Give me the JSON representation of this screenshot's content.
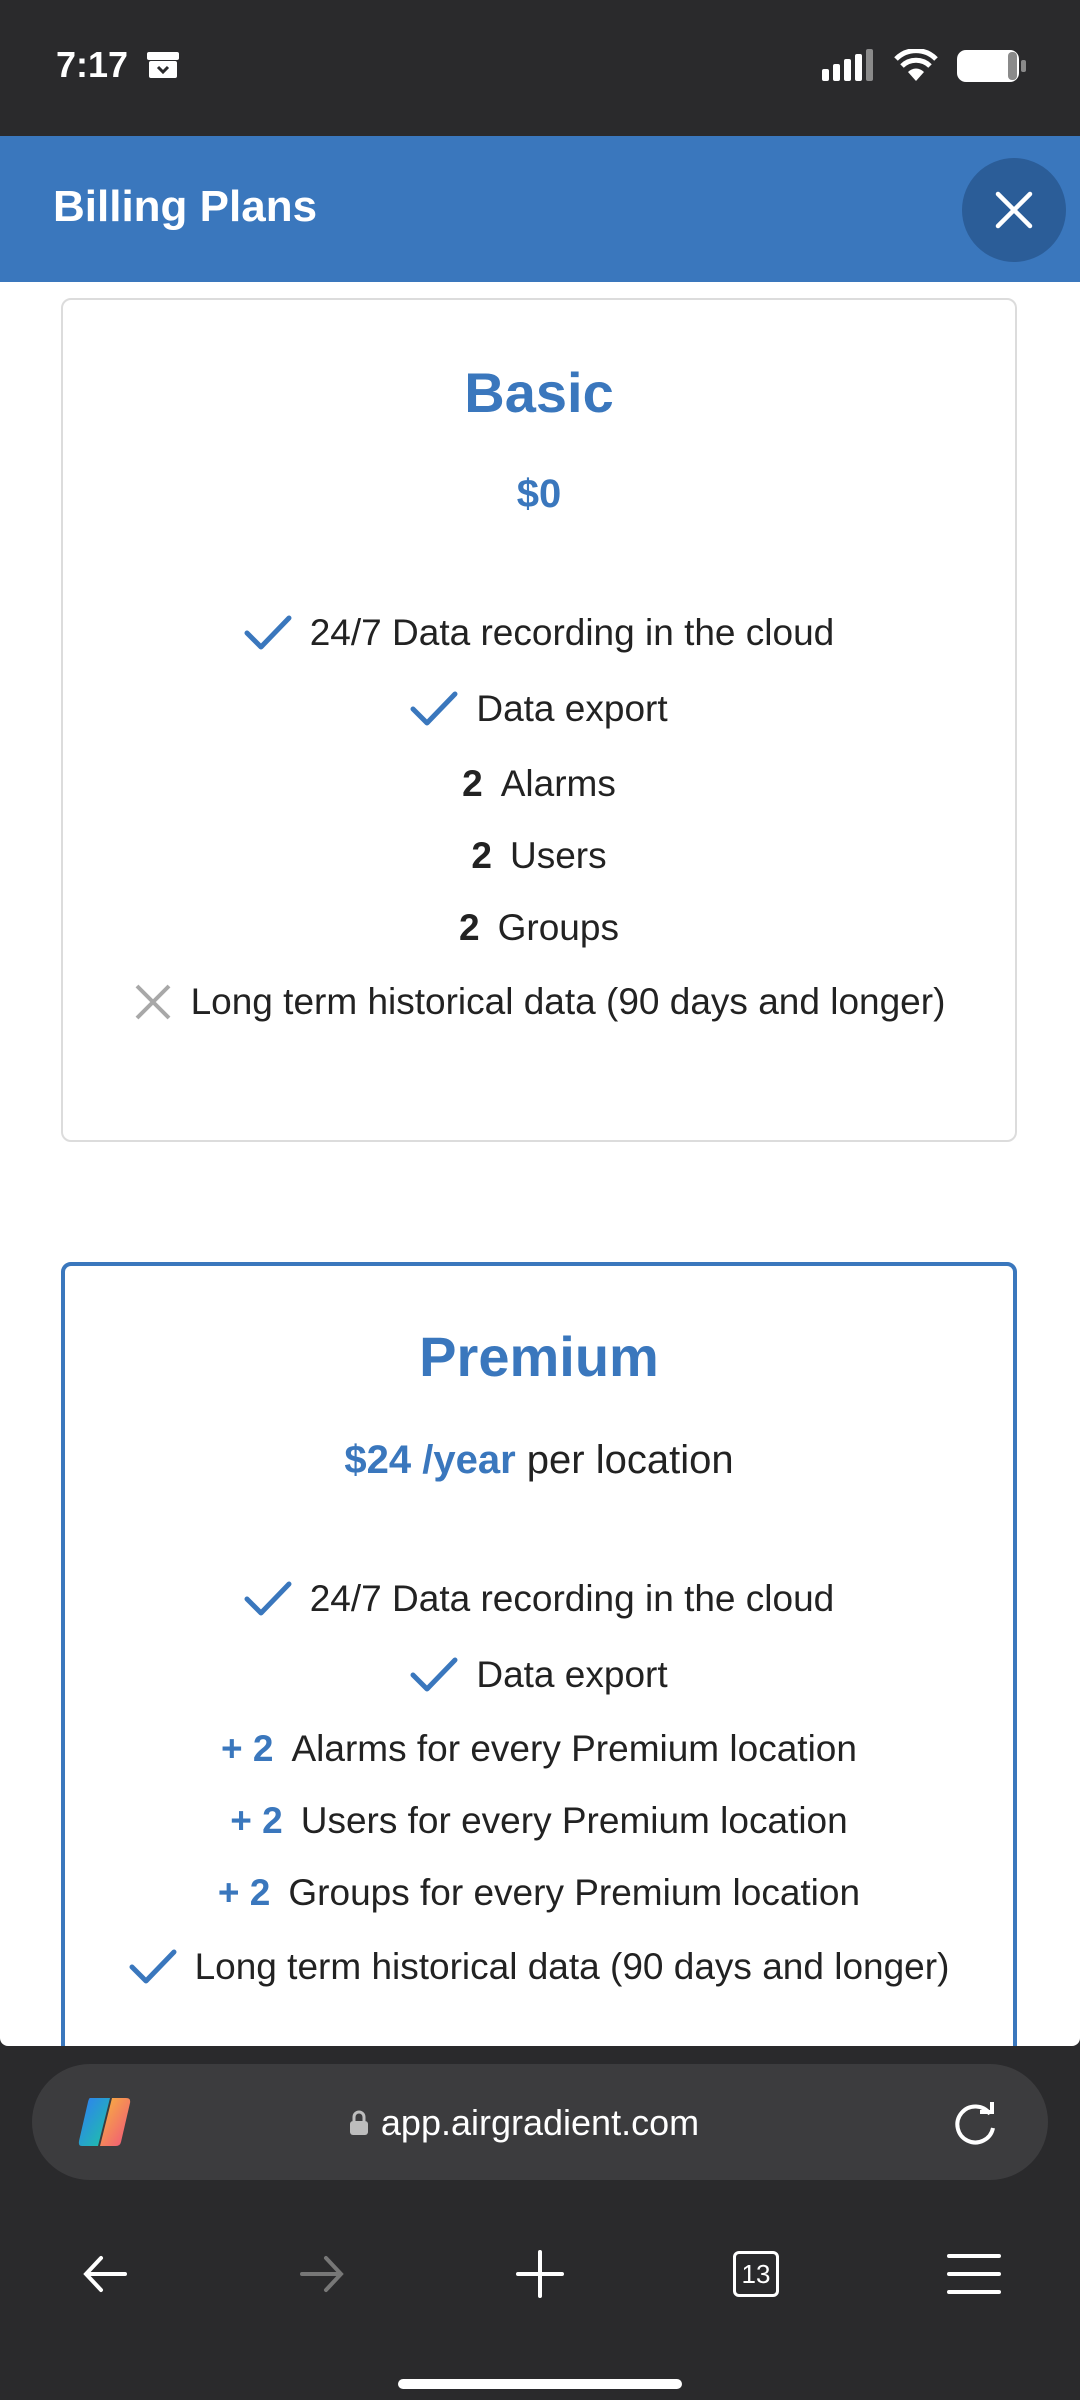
{
  "status": {
    "time": "7:17"
  },
  "header": {
    "title": "Billing Plans"
  },
  "plans": [
    {
      "name": "Basic",
      "price": "$0",
      "features": [
        {
          "icon": "check-icon",
          "qty": "",
          "text": "24/7 Data recording in the cloud"
        },
        {
          "icon": "check-icon",
          "qty": "",
          "text": "Data export"
        },
        {
          "icon": "",
          "qty": "2",
          "text": "Alarms"
        },
        {
          "icon": "",
          "qty": "2",
          "text": "Users"
        },
        {
          "icon": "",
          "qty": "2",
          "text": "Groups"
        },
        {
          "icon": "x-icon",
          "qty": "",
          "text": "Long term historical data (90 days and longer)"
        }
      ]
    },
    {
      "name": "Premium",
      "price": "$24 /year",
      "price_suffix": "per location",
      "features": [
        {
          "icon": "check-icon",
          "qty": "",
          "text": "24/7 Data recording in the cloud"
        },
        {
          "icon": "check-icon",
          "qty": "",
          "text": "Data export"
        },
        {
          "icon": "",
          "qty": "+ 2",
          "text": "Alarms for every Premium location"
        },
        {
          "icon": "",
          "qty": "+ 2",
          "text": "Users for every Premium location"
        },
        {
          "icon": "",
          "qty": "+ 2",
          "text": "Groups for every Premium location"
        },
        {
          "icon": "check-icon",
          "qty": "",
          "text": "Long term historical data (90 days and longer)"
        }
      ]
    }
  ],
  "browser": {
    "url": "app.airgradient.com",
    "tab_count": "13"
  },
  "colors": {
    "accent": "#3a77bd",
    "header_bg": "#3a77bd",
    "close_bg": "#2b5d98"
  }
}
